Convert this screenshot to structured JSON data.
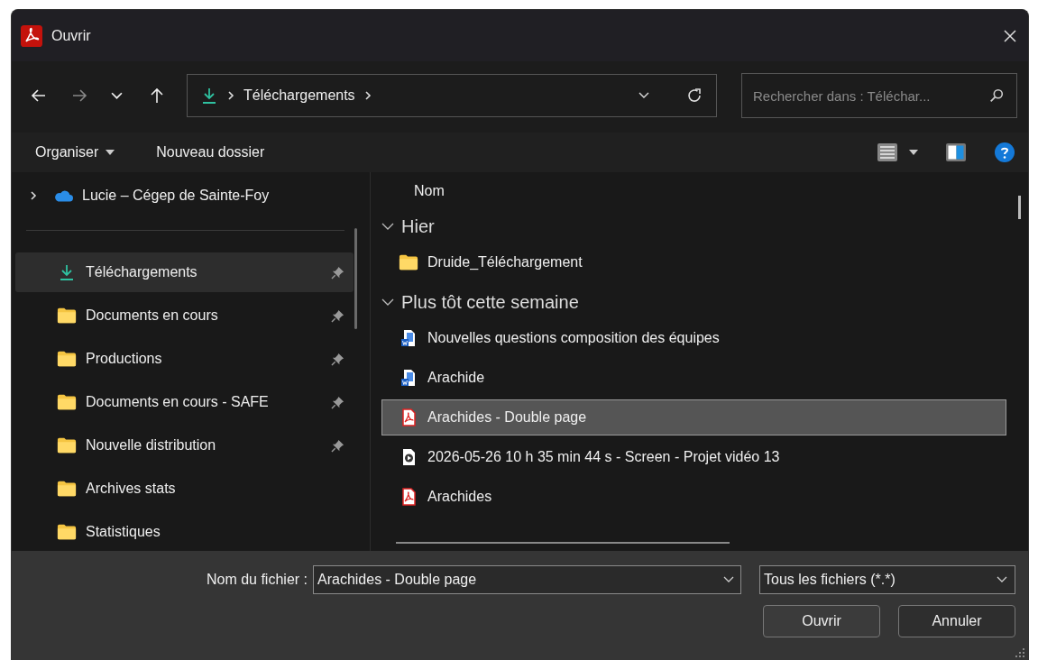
{
  "window": {
    "title": "Ouvrir"
  },
  "nav_buttons": [
    {
      "kind": "back",
      "disabled": false
    },
    {
      "kind": "forward",
      "disabled": true
    },
    {
      "kind": "recent",
      "disabled": false
    },
    {
      "kind": "up",
      "disabled": false
    }
  ],
  "address": {
    "segments": [
      "Téléchargements"
    ]
  },
  "search": {
    "placeholder": "Rechercher dans : Téléchar..."
  },
  "toolbar": {
    "organize": "Organiser",
    "new_folder": "Nouveau dossier"
  },
  "sidebar": {
    "top": {
      "label": "Lucie – Cégep de Sainte-Foy",
      "expanded": false
    },
    "items": [
      {
        "label": "Téléchargements",
        "kind": "download",
        "pinned": true,
        "selected": true
      },
      {
        "label": "Documents en cours",
        "kind": "folder",
        "pinned": true,
        "selected": false
      },
      {
        "label": "Productions",
        "kind": "folder",
        "pinned": true,
        "selected": false
      },
      {
        "label": "Documents en cours - SAFE",
        "kind": "folder",
        "pinned": true,
        "selected": false
      },
      {
        "label": "Nouvelle distribution",
        "kind": "folder",
        "pinned": true,
        "selected": false
      },
      {
        "label": "Archives stats",
        "kind": "folder",
        "pinned": false,
        "selected": false
      },
      {
        "label": "Statistiques",
        "kind": "folder",
        "pinned": false,
        "selected": false
      }
    ]
  },
  "files": {
    "column": "Nom",
    "groups": [
      {
        "label": "Hier",
        "expanded": true,
        "items": [
          {
            "name": "Druide_Téléchargement",
            "kind": "folder",
            "selected": false
          }
        ]
      },
      {
        "label": "Plus tôt cette semaine",
        "expanded": true,
        "items": [
          {
            "name": "Nouvelles questions composition des équipes",
            "kind": "word",
            "selected": false
          },
          {
            "name": "Arachide",
            "kind": "word",
            "selected": false
          },
          {
            "name": "Arachides - Double page",
            "kind": "pdf",
            "selected": true
          },
          {
            "name": "2026-05-26 10 h 35 min 44 s - Screen - Projet vidéo 13",
            "kind": "video",
            "selected": false
          },
          {
            "name": "Arachides",
            "kind": "pdf",
            "selected": false
          }
        ]
      }
    ]
  },
  "footer": {
    "filename_label": "Nom du fichier :",
    "filename": "Arachides - Double page",
    "filter": "Tous les fichiers (*.*)",
    "buttons": [
      {
        "label": "Ouvrir",
        "kind": "primary"
      },
      {
        "label": "Annuler",
        "kind": "cancel"
      }
    ]
  }
}
